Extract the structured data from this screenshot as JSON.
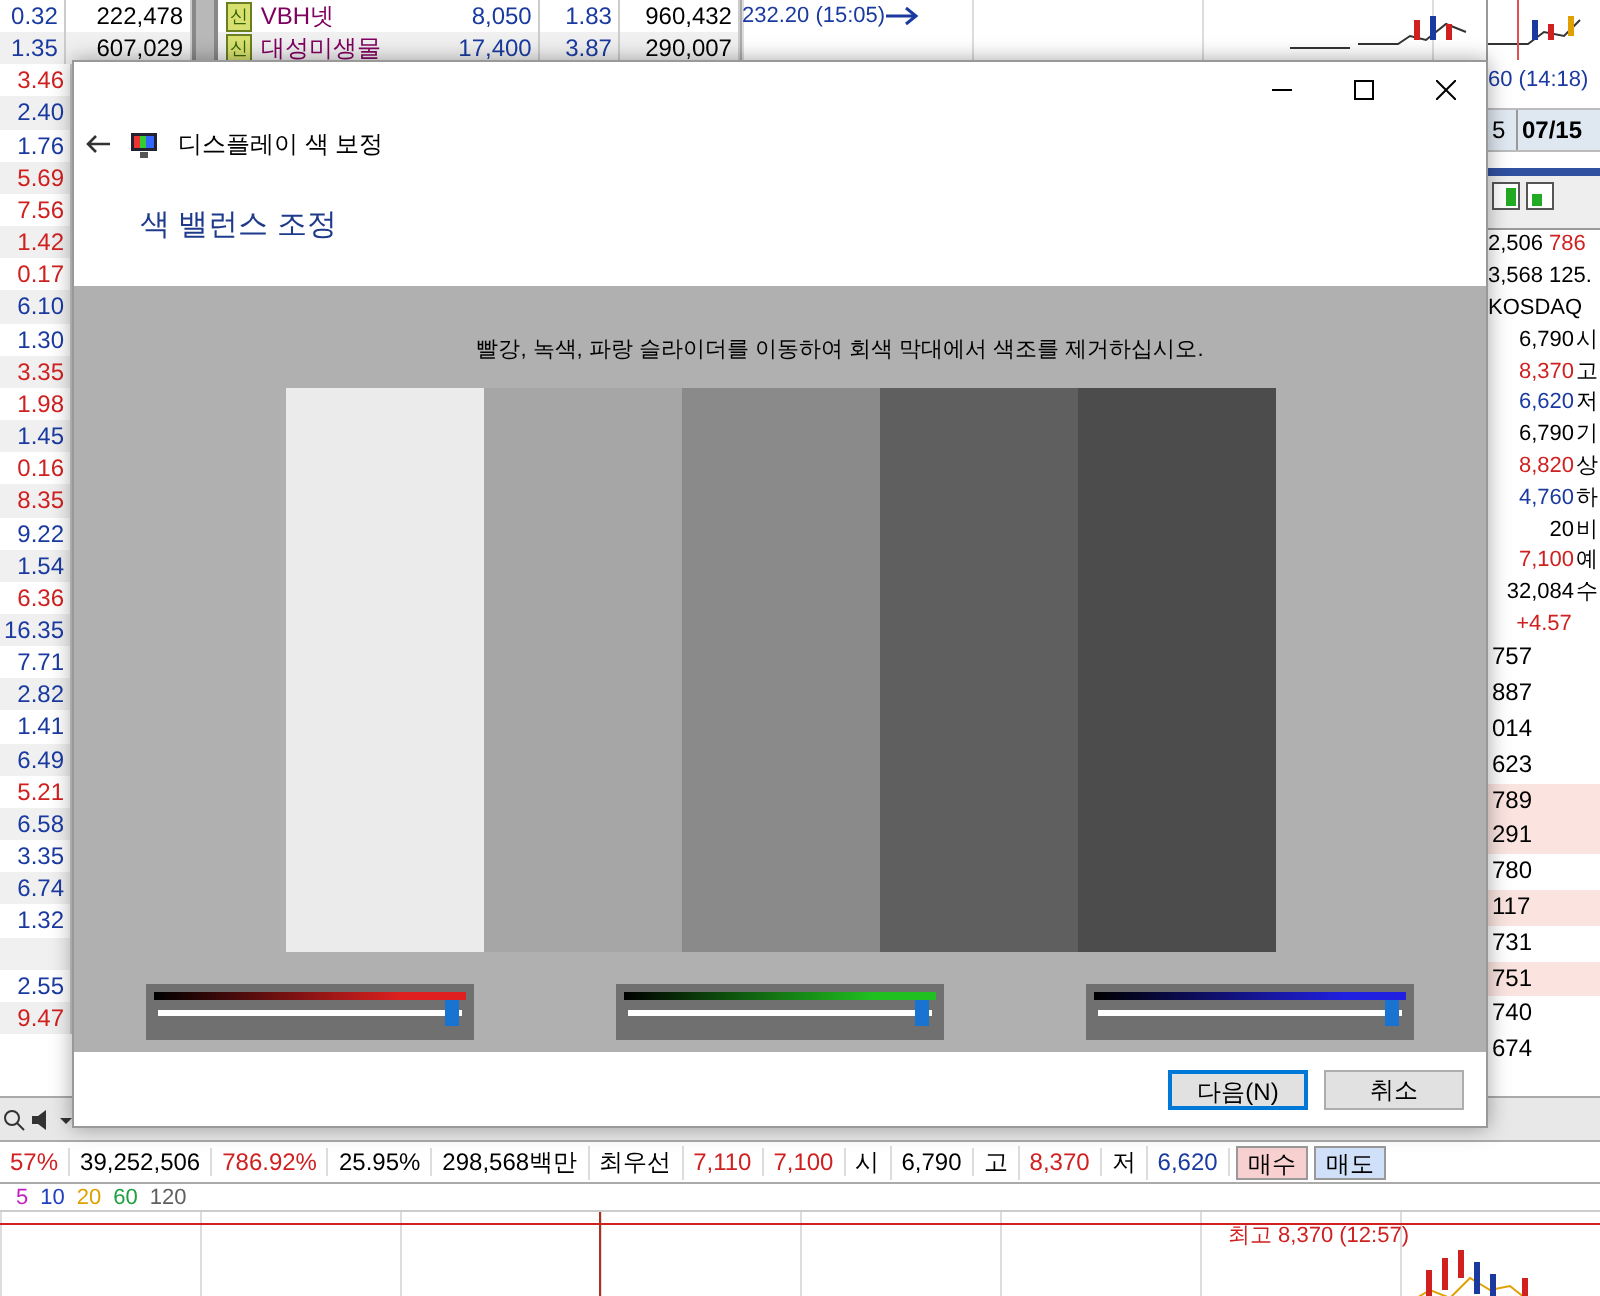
{
  "stock_table": {
    "rows": [
      {
        "column_1": "0.32",
        "color": "#1a3aa0",
        "column_2": "222,478",
        "badge": "신",
        "column_3": "VBH넷",
        "column_4": "8,050",
        "column_5": "1.83",
        "column_6": "960,432"
      },
      {
        "column_1": "1.35",
        "color": "#1a3aa0",
        "column_2": "607,029",
        "badge": "신",
        "column_3": "대성미생물",
        "column_4": "17,400",
        "column_5": "3.87",
        "column_6": "290,007"
      },
      {
        "column_1": "3.46",
        "color": "#d02020"
      },
      {
        "column_1": "2.40",
        "color": "#1a3aa0"
      },
      {
        "column_1": "1.76",
        "color": "#1a3aa0"
      },
      {
        "column_1": "5.69",
        "color": "#d02020"
      },
      {
        "column_1": "7.56",
        "color": "#d02020"
      },
      {
        "column_1": "1.42",
        "color": "#d02020"
      },
      {
        "column_1": "0.17",
        "color": "#d02020"
      },
      {
        "column_1": "6.10",
        "color": "#1a3aa0"
      },
      {
        "column_1": "1.30",
        "color": "#1a3aa0"
      },
      {
        "column_1": "3.35",
        "color": "#d02020"
      },
      {
        "column_1": "1.98",
        "color": "#d02020"
      },
      {
        "column_1": "1.45",
        "color": "#1a3aa0"
      },
      {
        "column_1": "0.16",
        "color": "#d02020"
      },
      {
        "column_1": "8.35",
        "color": "#d02020"
      },
      {
        "column_1": "9.22",
        "color": "#1a3aa0"
      },
      {
        "column_1": "1.54",
        "color": "#1a3aa0"
      },
      {
        "column_1": "6.36",
        "color": "#d02020"
      },
      {
        "column_1": "16.35",
        "color": "#1a3aa0"
      },
      {
        "column_1": "7.71",
        "color": "#1a3aa0"
      },
      {
        "column_1": "2.82",
        "color": "#1a3aa0"
      },
      {
        "column_1": "1.41",
        "color": "#1a3aa0"
      },
      {
        "column_1": "6.49",
        "color": "#1a3aa0"
      },
      {
        "column_1": "5.21",
        "color": "#d02020"
      },
      {
        "column_1": "6.58",
        "color": "#1a3aa0"
      },
      {
        "column_1": "3.35",
        "color": "#1a3aa0"
      },
      {
        "column_1": "6.74",
        "color": "#1a3aa0"
      },
      {
        "column_1": "1.32",
        "color": "#1a3aa0"
      },
      {},
      {
        "column_1": "2.55",
        "color": "#1a3aa0"
      },
      {
        "column_1": "9.47",
        "color": "#d02020"
      }
    ]
  },
  "top_chart": {
    "label": "232.20 (15:05)"
  },
  "right_panel": {
    "chart_label": "60 (14:18)",
    "date_cells": [
      "5",
      "07/15"
    ],
    "summary_rows": [
      {
        "cells": [
          {
            "text": "2,506",
            "color": "#000000"
          },
          {
            "text": "786",
            "color": "#d02020"
          }
        ]
      },
      {
        "cells": [
          {
            "text": "3,568",
            "color": "#000000"
          },
          {
            "text": "125.",
            "color": "#000000"
          }
        ]
      }
    ],
    "market": "KOSDAQ",
    "quotes": [
      {
        "cells": [
          {
            "text": "6,790",
            "color": "#000000"
          },
          {
            "text": "시"
          }
        ]
      },
      {
        "cells": [
          {
            "text": "8,370",
            "color": "#d02020"
          },
          {
            "text": "고"
          }
        ]
      },
      {
        "cells": [
          {
            "text": "6,620",
            "color": "#1a3aa0"
          },
          {
            "text": "저"
          }
        ]
      },
      {
        "cells": [
          {
            "text": "6,790",
            "color": "#000000"
          },
          {
            "text": "기"
          }
        ]
      },
      {
        "cells": [
          {
            "text": "8,820",
            "color": "#d02020"
          },
          {
            "text": "상"
          }
        ]
      },
      {
        "cells": [
          {
            "text": "4,760",
            "color": "#1a3aa0"
          },
          {
            "text": "하"
          }
        ]
      },
      {
        "cells": [
          {
            "text": "20",
            "color": "#000000"
          },
          {
            "text": "비"
          }
        ]
      }
    ],
    "quotes_2": [
      {
        "cells": [
          {
            "text": "7,100",
            "color": "#d02020"
          },
          {
            "text": "예"
          }
        ]
      },
      {
        "cells": [
          {
            "text": "32,084",
            "color": "#000000"
          },
          {
            "text": "수"
          }
        ]
      }
    ],
    "change": "+4.57",
    "list": [
      {
        "text": "757",
        "highlighted": false
      },
      {
        "text": "887",
        "highlighted": false
      },
      {
        "text": "014",
        "highlighted": false
      },
      {
        "text": "623",
        "highlighted": false
      },
      {
        "text": "789",
        "highlighted": true
      },
      {
        "text": "291",
        "highlighted": true
      },
      {
        "text": "780",
        "highlighted": false
      },
      {
        "text": "117",
        "highlighted": true
      },
      {
        "text": "731",
        "highlighted": false
      },
      {
        "text": "751",
        "highlighted": true
      },
      {
        "text": "740",
        "highlighted": false
      },
      {
        "text": "674",
        "highlighted": false
      }
    ]
  },
  "stats_bar": {
    "cells": [
      {
        "text": "57%",
        "color": "#d02020"
      },
      {
        "text": "39,252,506",
        "color": "#000000"
      },
      {
        "text": "786.92%",
        "color": "#d02020"
      },
      {
        "text": "25.95%",
        "color": "#000000"
      },
      {
        "text": "298,568백만",
        "color": "#000000"
      },
      {
        "text": "최우선",
        "color": "#000000"
      },
      {
        "text": "7,110",
        "color": "#d02020"
      },
      {
        "text": "7,100",
        "color": "#d02020"
      },
      {
        "text": "시",
        "color": "#000000"
      },
      {
        "text": "6,790",
        "color": "#000000"
      },
      {
        "text": "고",
        "color": "#000000"
      },
      {
        "text": "8,370",
        "color": "#d02020"
      },
      {
        "text": "저",
        "color": "#000000"
      },
      {
        "text": "6,620",
        "color": "#1a3aa0"
      }
    ],
    "buttons": [
      {
        "label": "매수",
        "kind": "buy"
      },
      {
        "label": "매도",
        "kind": "sell"
      }
    ]
  },
  "legend": [
    {
      "text": "5",
      "color": "#c020c0"
    },
    {
      "text": "10",
      "color": "#2040c0"
    },
    {
      "text": "20",
      "color": "#e0a000"
    },
    {
      "text": "60",
      "color": "#20a040"
    },
    {
      "text": "120",
      "color": "#606060"
    }
  ],
  "price_chart": {
    "high_label": "최고 8,370 (12:57)"
  },
  "dialog": {
    "nav_title": "디스플레이 색 보정",
    "heading": "색 밸런스 조정",
    "instruction": "빨강, 녹색, 파랑 슬라이더를 이동하여 회색 막대에서 색조를 제거하십시오.",
    "gray_bars": [
      {
        "color": "#ebebeb"
      },
      {
        "color": "#a6a6a6"
      },
      {
        "color": "#8a8a8a"
      },
      {
        "color": "#5f5f5f"
      },
      {
        "color": "#4c4c4c"
      }
    ],
    "sliders": [
      {
        "color": "#e02020",
        "level": 0.97
      },
      {
        "color": "#20c020",
        "level": 0.97
      },
      {
        "color": "#2020e0",
        "level": 0.97
      }
    ],
    "buttons": [
      {
        "label": "다음(N)",
        "default": true
      },
      {
        "label": "취소",
        "default": false
      }
    ]
  }
}
